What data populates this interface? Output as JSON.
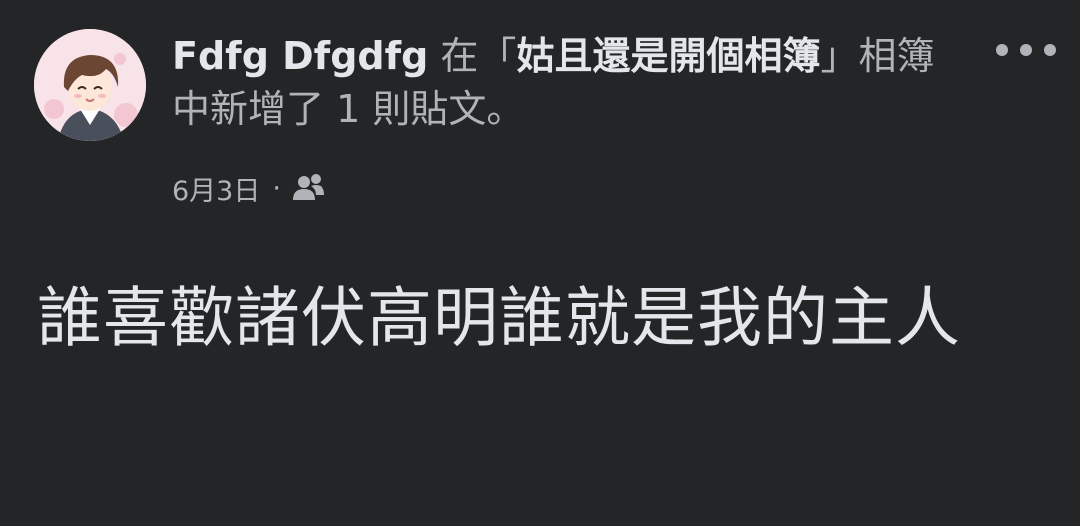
{
  "post": {
    "author": "Fdfg Dfgdfg",
    "action_prefix": " 在「",
    "album": "姑且還是開個相簿",
    "action_suffix": "」相簿中新增了 1 則貼文。",
    "date": "6月3日",
    "separator": "·",
    "audience_icon": "friends-icon",
    "more_icon": "more-options-icon",
    "body": "誰喜歡諸伏高明誰就是我的主人"
  },
  "colors": {
    "background": "#242526",
    "primary_text": "#e4e6eb",
    "secondary_text": "#b0b3b8"
  }
}
